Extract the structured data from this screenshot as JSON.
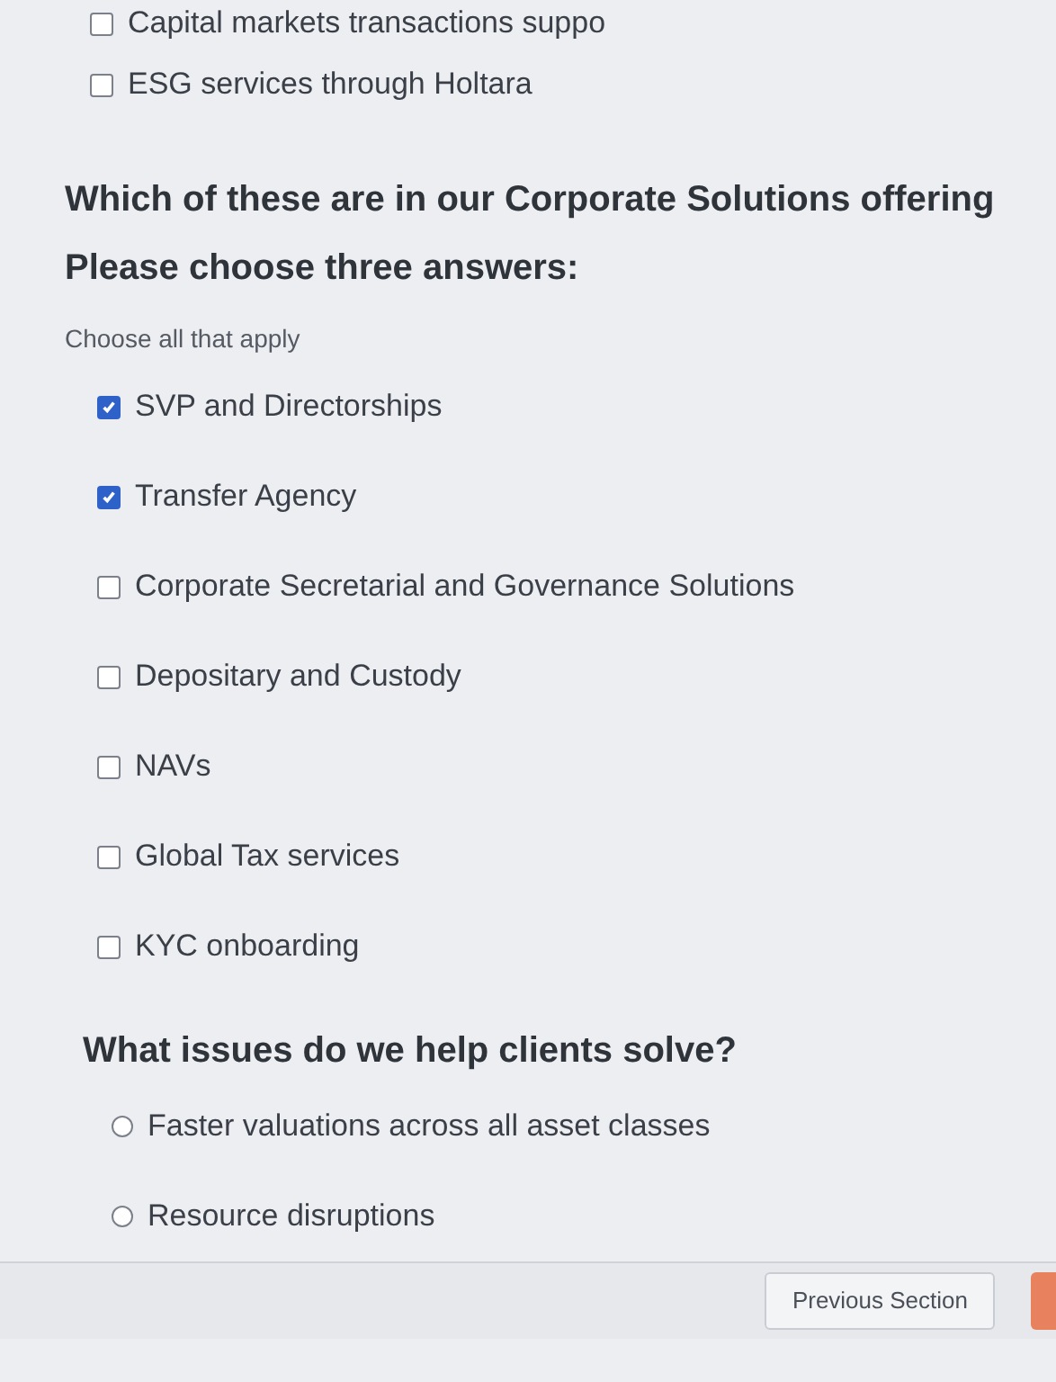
{
  "previous_options": [
    {
      "label": "Capital markets transactions suppo",
      "checked": false
    },
    {
      "label": "ESG services through Holtara",
      "checked": false
    }
  ],
  "questions": [
    {
      "kind": "checkbox",
      "title": "Which of these are in our Corporate Solutions offering",
      "instruction": "Please choose three answers:",
      "hint": "Choose all that apply",
      "options": [
        {
          "label": "SVP and Directorships",
          "checked": true
        },
        {
          "label": "Transfer Agency",
          "checked": true
        },
        {
          "label": "Corporate Secretarial and Governance Solutions",
          "checked": false
        },
        {
          "label": "Depositary and Custody",
          "checked": false
        },
        {
          "label": "NAVs",
          "checked": false
        },
        {
          "label": "Global Tax services",
          "checked": false
        },
        {
          "label": "KYC onboarding",
          "checked": false
        }
      ]
    },
    {
      "kind": "radio",
      "title": "What issues do we help clients solve?",
      "options": [
        {
          "label": "Faster valuations across all asset classes",
          "selected": false
        },
        {
          "label": "Resource disruptions",
          "selected": false
        }
      ]
    }
  ],
  "footer": {
    "previous_button": "Previous Section"
  }
}
